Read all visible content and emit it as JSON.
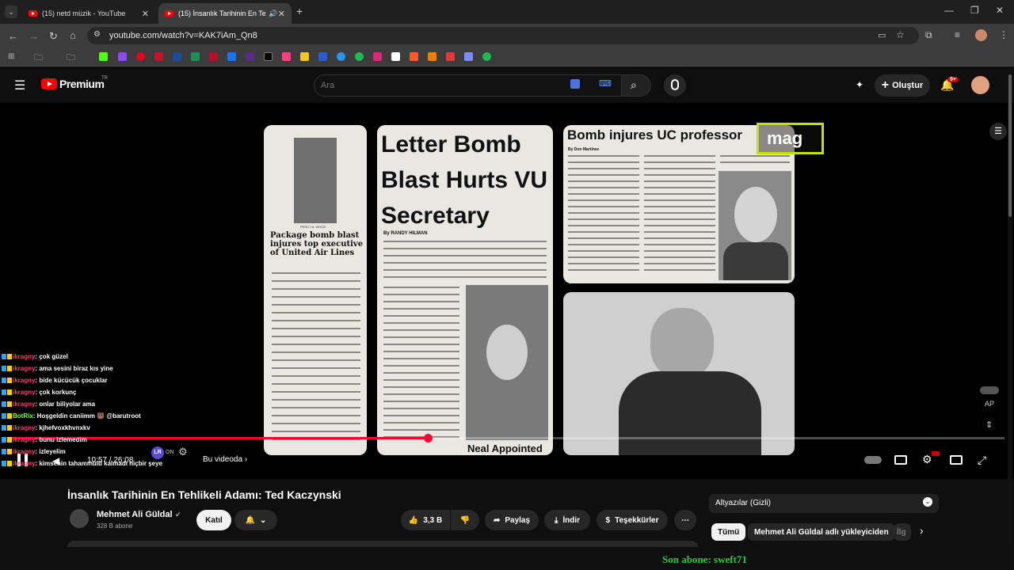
{
  "browser": {
    "tabs": [
      {
        "title": "(15) netd müzik - YouTube"
      },
      {
        "title": "(15) İnsanlık Tarihinin En Tehli"
      }
    ],
    "url": "youtube.com/watch?v=KAK7iAm_Qn8"
  },
  "youtube": {
    "logo_text": "Premium",
    "logo_region": "TR",
    "search_placeholder": "Ara",
    "create_label": "Oluştur",
    "notif_count": "9+"
  },
  "video": {
    "clippings": {
      "left_headline": "Package bomb blast injures top executive of United Air Lines",
      "left_caption": "PERCY A. WOOD",
      "middle_headline": "Letter Bomb Blast Hurts VU Secretary",
      "middle_byline": "By RANDY HILMAN",
      "middle_photo_caption": "Neal Appointed",
      "right_headline": "Bomb injures UC professor",
      "right_byline": "By Don Martinez",
      "overlay_label": "mag"
    },
    "time": "10:57 / 26:08",
    "chapter": "Bu videoda",
    "autoplay_label": "ON",
    "progress": 0.42
  },
  "chat": [
    {
      "nick": "ikragny",
      "text": ": çok güzel"
    },
    {
      "nick": "ikragny",
      "text": ": ama sesini biraz kıs yine"
    },
    {
      "nick": "ikragny",
      "text": ": bide kücücük çocuklar"
    },
    {
      "nick": "ikragny",
      "text": ": çok korkunç"
    },
    {
      "nick": "ikragny",
      "text": ": onlar biliyolar ama"
    },
    {
      "nick": "BotRix",
      "text": ": Hoşgeldin caniimm 🐻 @barutroot",
      "bot": true
    },
    {
      "nick": "ikragny",
      "text": ": kjhefvoxkhvnxkv"
    },
    {
      "nick": "ikragny",
      "text": ": bunu izlemedim"
    },
    {
      "nick": "ikragny",
      "text": ": izleyelim"
    },
    {
      "nick": "ikragny",
      "text": ": kimsenin tahammülü kalmadı hiçbir şeye"
    }
  ],
  "meta": {
    "title": "İnsanlık Tarihinin En Tehlikeli Adamı: Ted Kaczynski",
    "channel": "Mehmet Ali Güldal",
    "subscribers": "328 B abone",
    "join_label": "Katıl",
    "likes": "3,3 B",
    "share_label": "Paylaş",
    "download_label": "İndir",
    "thanks_label": "Teşekkürler"
  },
  "sidebar": {
    "transcript_label": "Altyazılar (Gizli)",
    "chips": [
      "Tümü",
      "Mehmet Ali Güldal adlı yükleyiciden",
      "İlg"
    ]
  },
  "overlay": {
    "last_subscriber": "Son abone: sweft71"
  },
  "side_label": "AP"
}
